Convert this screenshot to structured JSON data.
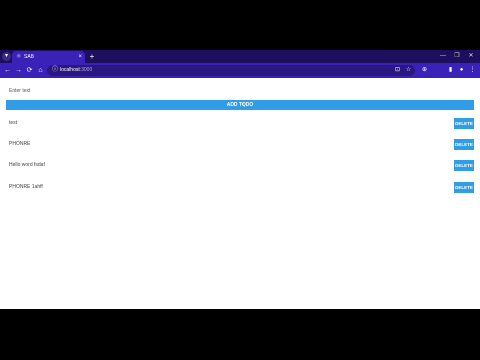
{
  "browser": {
    "tab_title": "SAB",
    "new_tab_symbol": "+",
    "close_symbol": "×",
    "menu_symbol": "▾",
    "window_controls": [
      "—",
      "❐",
      "✕"
    ],
    "url_host": "localhost",
    "url_port": ":3000",
    "nav_symbols": [
      "←",
      "→",
      "⟳",
      "⌂"
    ],
    "toolbar_icons": [
      "⊡",
      "☆",
      "⊕",
      "▮",
      "●",
      "⋮"
    ]
  },
  "app": {
    "input_label": "Enter text",
    "add_button_label": "ADD TODO",
    "delete_label": "DELETE",
    "items": [
      "test",
      "PHONRE",
      "Hello word fsdaf",
      "PHONRE 1ahff"
    ]
  },
  "colors": {
    "primary": "#2f9de8",
    "browser_chrome": "#3a22b8",
    "tabbar": "#1d0f5e"
  }
}
